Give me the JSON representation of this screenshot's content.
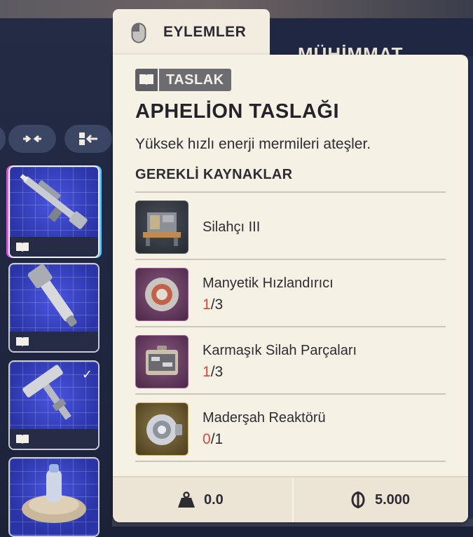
{
  "background": {
    "section_title": "MÜHİMMAT"
  },
  "controls": [
    {
      "name": "collapse-all-icon"
    },
    {
      "name": "sort-icon"
    }
  ],
  "inventory_slots": [
    {
      "item": "aphelion-rifle",
      "selected": true,
      "badge_icon": "book-icon",
      "checked": false
    },
    {
      "item": "launcher-tube",
      "selected": false,
      "badge_icon": "book-icon",
      "checked": false
    },
    {
      "item": "heavy-hammer",
      "selected": false,
      "badge_icon": "book-icon",
      "checked": true
    },
    {
      "item": "deployable-device",
      "selected": false,
      "badge_icon": "",
      "checked": false
    }
  ],
  "actions_tab": {
    "icon": "mouse-icon",
    "label": "EYLEMLER"
  },
  "tooltip": {
    "badge": {
      "icon": "book-icon",
      "label": "TASLAK"
    },
    "title": "APHELİON TASLAĞI",
    "description": "Yüksek hızlı enerji mermileri ateşler.",
    "requirements_heading": "GEREKLİ KAYNAKLAR",
    "requirements": [
      {
        "name": "Silahçı III",
        "rarity": "common",
        "have": "",
        "sep": "",
        "need": ""
      },
      {
        "name": "Manyetik Hızlandırıcı",
        "rarity": "epic",
        "have": "1",
        "sep": "/",
        "need": "3"
      },
      {
        "name": "Karmaşık Silah Parçaları",
        "rarity": "epic",
        "have": "1",
        "sep": "/",
        "need": "3"
      },
      {
        "name": "Maderşah Reaktörü",
        "rarity": "legendary",
        "have": "0",
        "sep": "/",
        "need": "1"
      }
    ],
    "footer": {
      "weight_icon": "weight-icon",
      "weight": "0.0",
      "price_icon": "coin-icon",
      "price": "5.000"
    }
  },
  "colors": {
    "tooltip_bg": "#f6f1e5",
    "missing_count": "#d84a3c",
    "slot_bg": "#2b35a8",
    "epic_frame": "#a05a98",
    "legendary_frame": "#d4b25a"
  }
}
